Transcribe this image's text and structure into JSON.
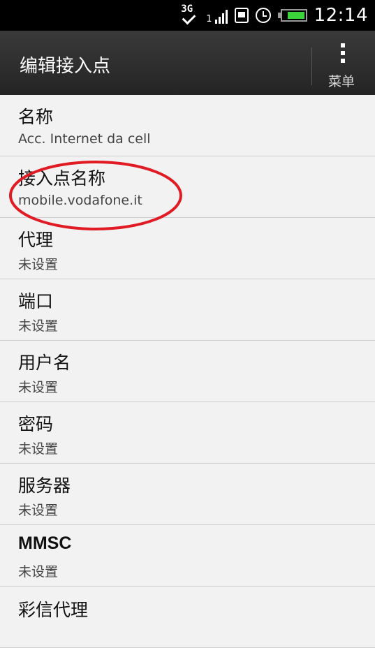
{
  "status_bar": {
    "network": "3G",
    "signal_prefix": "1",
    "time": "12:14",
    "battery_level": 0.8,
    "battery_color": "#3bd43b",
    "icons": [
      "3g-icon",
      "signal-icon",
      "sim-icon",
      "alarm-icon",
      "battery-icon"
    ]
  },
  "action_bar": {
    "title": "编辑接入点",
    "menu_label": "菜单",
    "menu_icon": "overflow-menu-icon"
  },
  "items": [
    {
      "label": "名称",
      "value": "Acc. Internet da cell"
    },
    {
      "label": "接入点名称",
      "value": "mobile.vodafone.it"
    },
    {
      "label": "代理",
      "value": "未设置"
    },
    {
      "label": "端口",
      "value": "未设置"
    },
    {
      "label": "用户名",
      "value": "未设置"
    },
    {
      "label": "密码",
      "value": "未设置"
    },
    {
      "label": "服务器",
      "value": "未设置"
    },
    {
      "label": "MMSC",
      "value": "未设置"
    },
    {
      "label": "彩信代理",
      "value": ""
    }
  ],
  "annotation": {
    "color": "#e01b24",
    "target": "接入点名称"
  }
}
